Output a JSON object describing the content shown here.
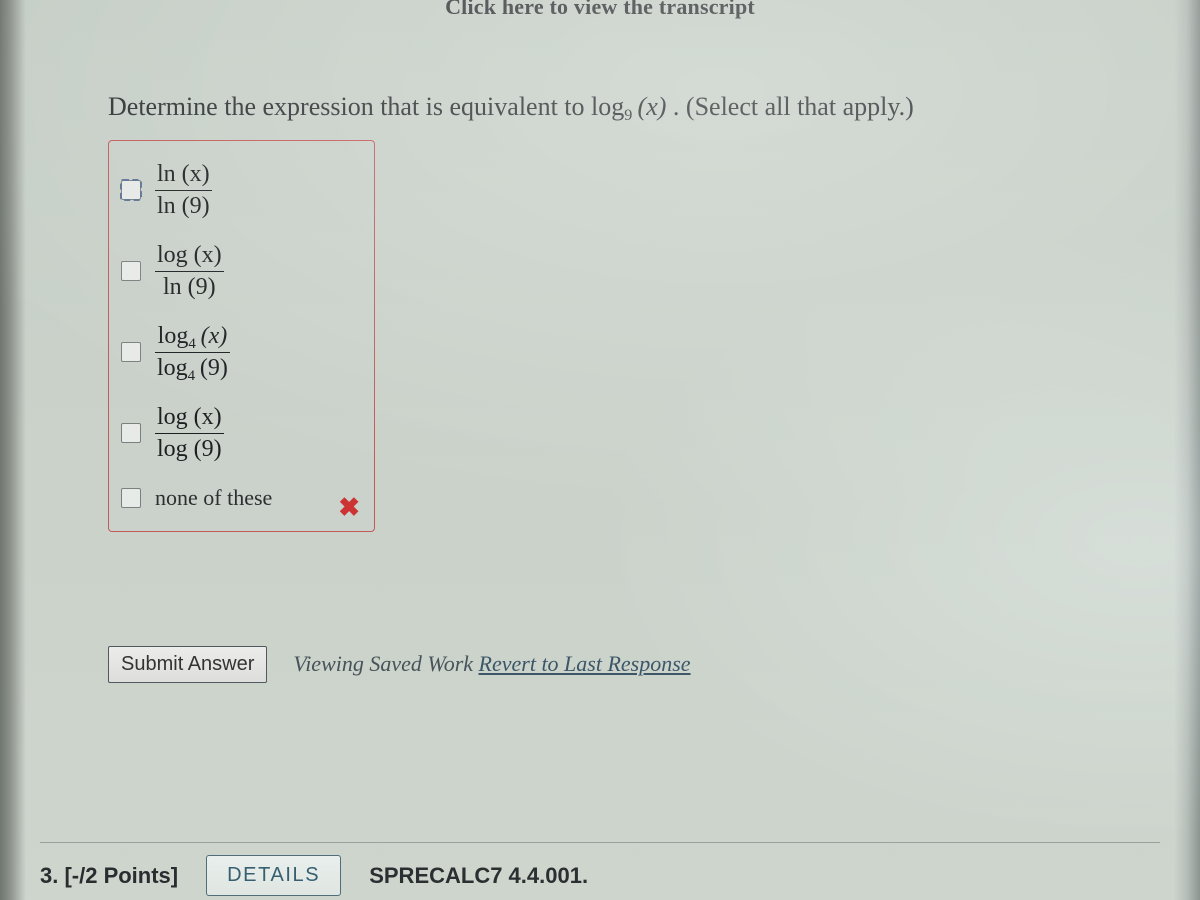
{
  "partial_header": "Click here to view the transcript",
  "question": {
    "prefix": "Determine the expression that is equivalent to ",
    "expr_base": "log",
    "expr_sub": "9",
    "expr_arg": "(x)",
    "suffix": ". (Select all that apply.)"
  },
  "options": [
    {
      "num1": "ln (x)",
      "den1": "ln (9)",
      "focused": true
    },
    {
      "num1": "log (x)",
      "den1": "ln (9)",
      "focused": false
    },
    {
      "num_base": "log",
      "num_sub": "4",
      "num_arg": "(x)",
      "den_base": "log",
      "den_sub": "4",
      "den_arg": "(9)",
      "focused": false
    },
    {
      "num1": "log (x)",
      "den1": "log (9)",
      "focused": false
    },
    {
      "plain": "none of these",
      "focused": false
    }
  ],
  "wrong_mark": "✖",
  "submit_label": "Submit Answer",
  "status_prefix": "Viewing Saved Work ",
  "status_link": "Revert to Last Response",
  "next_q": {
    "label": "3.  [-/2 Points]",
    "details": "DETAILS",
    "ref": "SPRECALC7 4.4.001."
  }
}
